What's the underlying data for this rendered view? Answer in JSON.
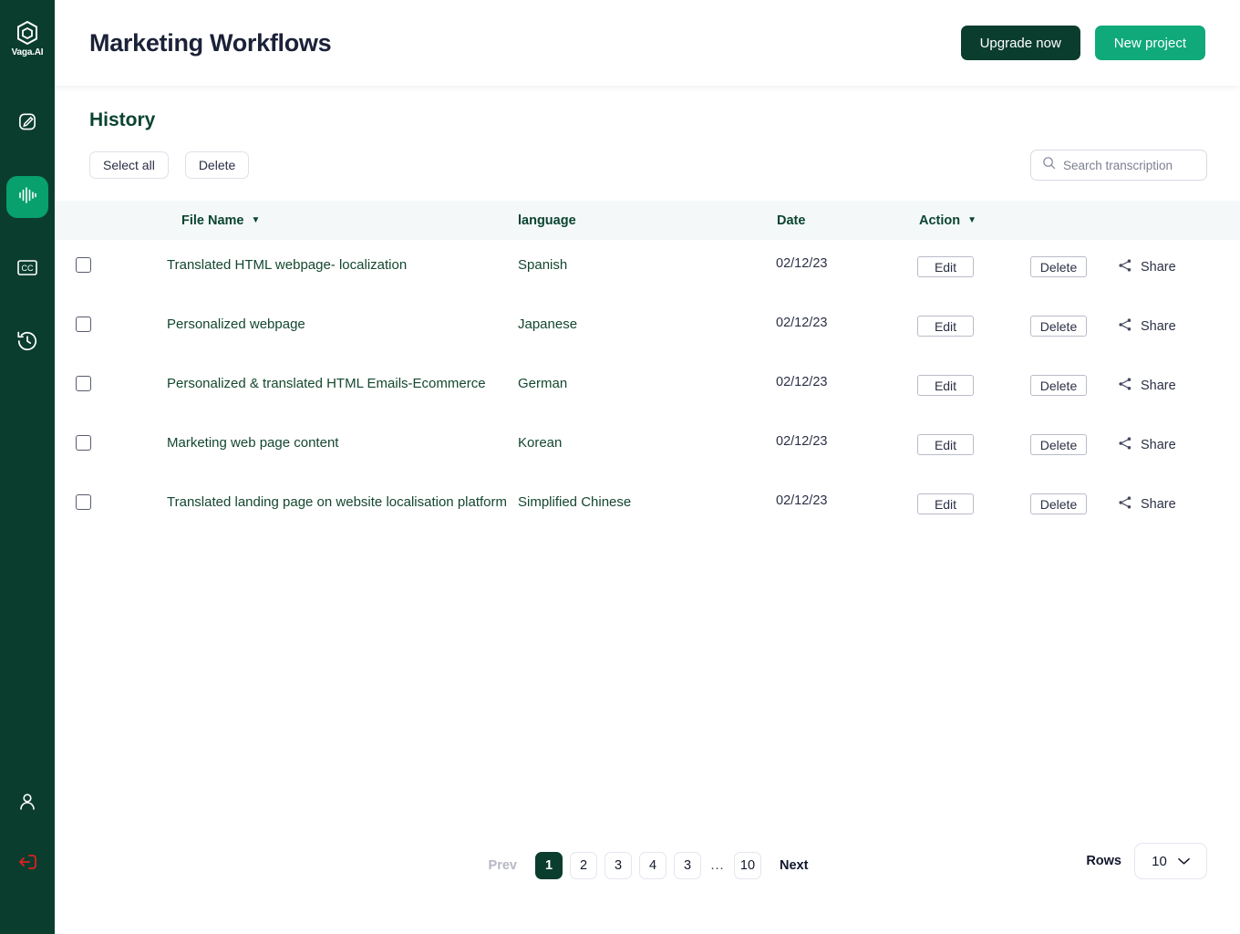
{
  "sidebar": {
    "logo": {
      "name": "vaga-hex-logo",
      "label": "Vaga.AI"
    },
    "items": [
      {
        "icon": "edit-pencil-icon",
        "name": "sidebar-item-edit",
        "active": false
      },
      {
        "icon": "audio-waveform-icon",
        "name": "sidebar-item-transcribe",
        "active": true
      },
      {
        "icon": "closed-caption-icon",
        "name": "sidebar-item-captions",
        "active": false
      },
      {
        "icon": "history-clock-icon",
        "name": "sidebar-item-history",
        "active": false
      }
    ],
    "bottom_items": [
      {
        "icon": "user-profile-icon",
        "name": "sidebar-item-profile"
      },
      {
        "icon": "logout-icon",
        "name": "sidebar-item-logout"
      }
    ]
  },
  "header": {
    "title": "Marketing Workflows",
    "upgrade_label": "Upgrade now",
    "new_project_label": "New project"
  },
  "section": {
    "title": "History",
    "select_all_label": "Select all",
    "delete_label": "Delete"
  },
  "search": {
    "placeholder": "Search transcription",
    "value": "",
    "icon": "search-icon"
  },
  "table": {
    "columns": [
      {
        "label": "File Name",
        "sortable": true
      },
      {
        "label": "language",
        "sortable": false
      },
      {
        "label": "Date",
        "sortable": false
      },
      {
        "label": "Action",
        "sortable": true
      }
    ],
    "actions": {
      "edit": "Edit",
      "delete": "Delete",
      "share": "Share"
    },
    "rows": [
      {
        "name": "Translated HTML webpage- localization",
        "language": "Spanish",
        "date": "02/12/23"
      },
      {
        "name": "Personalized  webpage",
        "language": "Japanese",
        "date": "02/12/23"
      },
      {
        "name": " Personalized & translated HTML Emails-Ecommerce",
        "language": "German",
        "date": "02/12/23"
      },
      {
        "name": "Marketing web page content",
        "language": "Korean",
        "date": "02/12/23"
      },
      {
        "name": "Translated landing page on website localisation platform",
        "language": "Simplified Chinese",
        "date": "02/12/23"
      }
    ]
  },
  "pagination": {
    "prev_label": "Prev",
    "next_label": "Next",
    "pages": [
      "1",
      "2",
      "3",
      "4",
      "3",
      "...",
      "10"
    ],
    "active_page": "1",
    "rows_label": "Rows",
    "rows_value": "10"
  },
  "colors": {
    "sidebar_bg": "#0b3d2e",
    "accent_green": "#10a97a",
    "active_nav": "#08a06d",
    "title_dark": "#1b2138",
    "heading_green": "#0b4430",
    "table_header_bg": "#f4f8f9",
    "logout_red": "#e01f1f"
  }
}
